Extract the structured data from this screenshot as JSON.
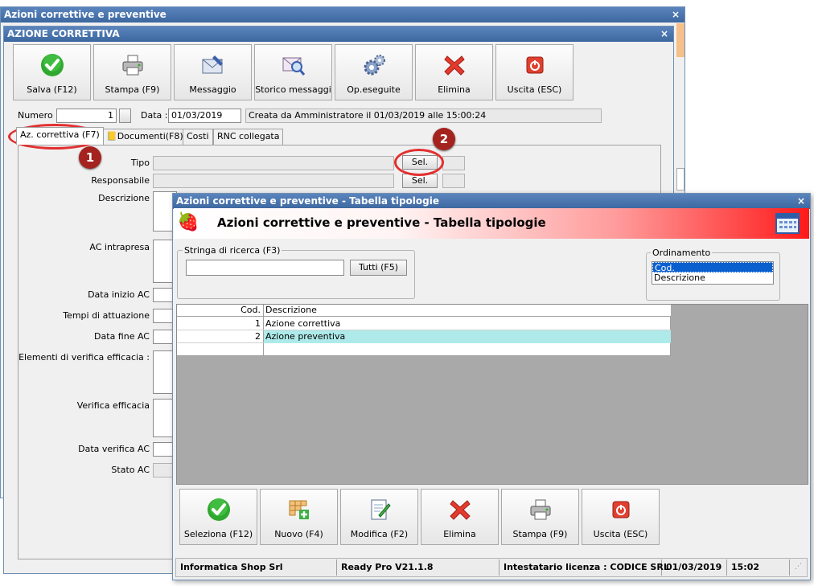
{
  "back_window": {
    "title": "Azioni correttive e preventive",
    "close": "×"
  },
  "main_window": {
    "title": "AZIONE CORRETTIVA",
    "close": "×",
    "toolbar": [
      {
        "label": "Salva (F12)",
        "icon": "check-icon"
      },
      {
        "label": "Stampa (F9)",
        "icon": "printer-icon"
      },
      {
        "label": "Messaggio",
        "icon": "envelope-icon"
      },
      {
        "label": "Storico messaggi",
        "icon": "mail-search-icon"
      },
      {
        "label": "Op.eseguite",
        "icon": "gears-icon"
      },
      {
        "label": "Elimina",
        "icon": "delete-x-icon"
      },
      {
        "label": "Uscita (ESC)",
        "icon": "power-icon"
      }
    ],
    "numero_label": "Numero :",
    "numero_value": "1",
    "data_label": "Data :",
    "data_value": "01/03/2019",
    "created_info": "Creata da Amministratore il 01/03/2019 alle 15:00:24",
    "tabs": [
      "Az. correttiva (F7)",
      "Documenti(F8)",
      "Costi",
      "RNC collegata"
    ],
    "form": {
      "tipo": "Tipo",
      "responsabile": "Responsabile",
      "descrizione": "Descrizione",
      "ac_intrapresa": "AC intrapresa",
      "data_inizio": "Data inizio AC",
      "tempi": "Tempi di attuazione",
      "data_fine": "Data fine AC",
      "elementi": "Elementi di verifica efficacia :",
      "verifica": "Verifica efficacia",
      "data_verifica": "Data verifica AC",
      "stato": "Stato AC",
      "sel_button": "Sel."
    }
  },
  "callouts": [
    "1",
    "2"
  ],
  "dialog": {
    "title": "Azioni correttive e preventive - Tabella tipologie",
    "close": "×",
    "header_title": "Azioni correttive e preventive - Tabella tipologie",
    "search_legend": "Stringa di ricerca (F3)",
    "search_value": "",
    "tutti_button": "Tutti (F5)",
    "ordinamento_legend": "Ordinamento",
    "ordinamento_options": [
      "Cod.",
      "Descrizione"
    ],
    "grid": {
      "columns": [
        "Cod.",
        "Descrizione"
      ],
      "rows": [
        {
          "cod": "1",
          "descrizione": "Azione correttiva"
        },
        {
          "cod": "2",
          "descrizione": "Azione preventiva"
        }
      ]
    },
    "buttons": [
      {
        "label": "Seleziona (F12)",
        "icon": "check-icon"
      },
      {
        "label": "Nuovo (F4)",
        "icon": "new-grid-icon"
      },
      {
        "label": "Modifica (F2)",
        "icon": "edit-icon"
      },
      {
        "label": "Elimina",
        "icon": "delete-x-icon"
      },
      {
        "label": "Stampa (F9)",
        "icon": "printer-icon"
      },
      {
        "label": "Uscita (ESC)",
        "icon": "power-icon"
      }
    ],
    "status": {
      "company": "Informatica Shop Srl",
      "version": "Ready Pro V21.1.8",
      "license": "Intestatario licenza : CODICE SRL",
      "date": "01/03/2019",
      "time": "15:02"
    }
  }
}
